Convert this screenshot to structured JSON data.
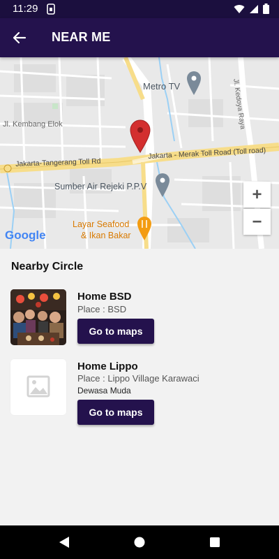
{
  "status_bar": {
    "time": "11:29",
    "icons": [
      "sim-icon",
      "wifi-icon",
      "signal-icon",
      "battery-icon"
    ]
  },
  "app_bar": {
    "title": "NEAR ME",
    "back_icon": "arrow-back-icon"
  },
  "map": {
    "labels": {
      "metro_tv": "Metro TV",
      "kembang_elok": "Jl. Kembang Elok",
      "kedoya_raya": "Jl. Kedoya Raya",
      "toll_rd": "Jakarta-Tangerang Toll Rd",
      "toll_road": "Jakarta - Merak Toll Road (Toll road)",
      "sumber_air": "Sumber Air Rejeki P.P.V",
      "layar_line1": "Layar Seafood",
      "layar_line2": "& Ikan Bakar",
      "google": "Google"
    },
    "zoom_in": "+",
    "zoom_out": "−",
    "colors": {
      "marker": "#d32f2f",
      "pin": "#7a8a99",
      "restaurant": "#f39c12",
      "water": "#9bd0f5",
      "major_road": "#f7dd8a"
    }
  },
  "nearby": {
    "title": "Nearby Circle",
    "circles": [
      {
        "name": "Home BSD",
        "place": "Place : BSD",
        "extra": "",
        "button": "Go to maps",
        "thumb": "group-photo"
      },
      {
        "name": "Home Lippo",
        "place": "Place : Lippo Village Karawaci",
        "extra": "Dewasa Muda",
        "button": "Go to maps",
        "thumb": "image-placeholder-icon"
      }
    ]
  },
  "nav_bar": {
    "back": "nav-back-icon",
    "home": "nav-home-icon",
    "recents": "nav-recents-icon"
  },
  "theme": {
    "primary": "#24124d",
    "status": "#1b0f3e"
  }
}
